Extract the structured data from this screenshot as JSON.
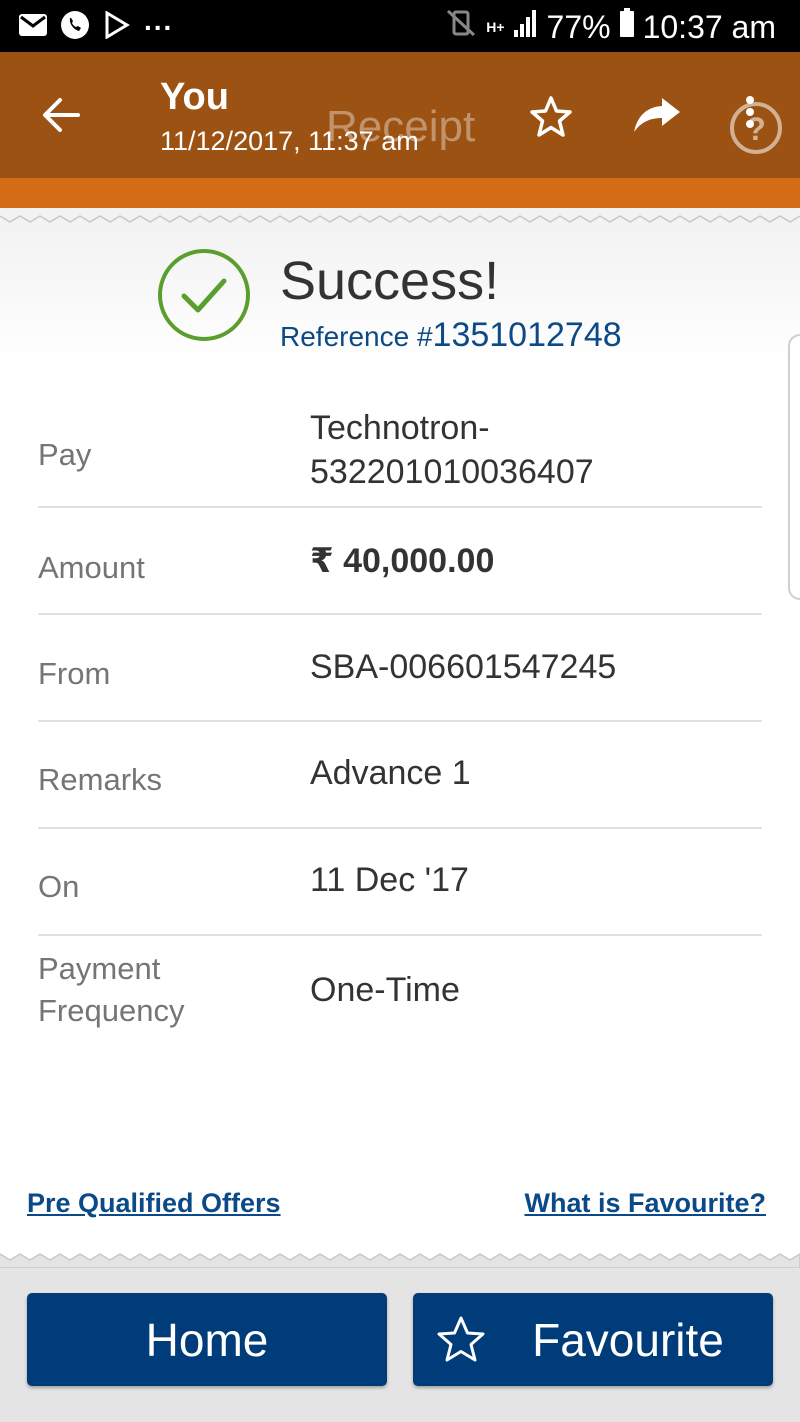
{
  "status_bar": {
    "more_indicator": "...",
    "network": "H+",
    "battery": "77%",
    "time": "10:37 am"
  },
  "header": {
    "title": "You",
    "subtitle": "11/12/2017, 11:37 am",
    "overlay_title": "Receipt",
    "icons": [
      "back-arrow-icon",
      "star-icon",
      "share-icon",
      "help-icon",
      "more-vert-icon"
    ]
  },
  "success": {
    "title": "Success!",
    "reference_label": "Reference #",
    "reference_number": "1351012748",
    "accent_color": "#5a9e2e"
  },
  "details": [
    {
      "label": "Pay",
      "value": "Technotron-\n532201010036407"
    },
    {
      "label": "Amount",
      "value": "₹ 40,000.00"
    },
    {
      "label": "From",
      "value": "SBA-006601547245"
    },
    {
      "label": "Remarks",
      "value": "Advance 1"
    },
    {
      "label": "On",
      "value": "11 Dec '17"
    },
    {
      "label": "Payment\nFrequency",
      "value": "One-Time"
    }
  ],
  "links": {
    "left": "Pre Qualified Offers",
    "right": "What is Favourite?"
  },
  "buttons": {
    "home": "Home",
    "favourite": "Favourite"
  },
  "colors": {
    "header_bg": "#9b5212",
    "strip": "#d56c17",
    "primary_blue": "#003b7a",
    "link_blue": "#0b4a86"
  }
}
